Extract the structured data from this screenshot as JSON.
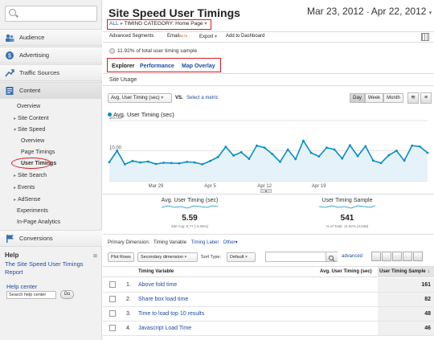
{
  "sidebar": {
    "sections": [
      {
        "label": "Audience",
        "icon": "audience-icon"
      },
      {
        "label": "Advertising",
        "icon": "advertising-icon"
      },
      {
        "label": "Traffic Sources",
        "icon": "traffic-sources-icon"
      },
      {
        "label": "Content",
        "icon": "content-icon"
      }
    ],
    "content_items": {
      "overview": "Overview",
      "site_content": "Site Content",
      "site_speed": "Site Speed",
      "speed_overview": "Overview",
      "page_timings": "Page Timings",
      "user_timings": "User Timings",
      "site_search": "Site Search",
      "events": "Events",
      "adsense": "AdSense",
      "experiments": "Experiments",
      "in_page": "In-Page Analytics"
    },
    "conversions": "Conversions",
    "help": {
      "header": "Help",
      "link": "The Site Speed User Timings Report",
      "help_center": "Help center",
      "search_placeholder": "Search help center",
      "go": "Go"
    }
  },
  "header": {
    "title": "Site Speed User Timings",
    "date_start": "Mar 23, 2012",
    "date_sep": "-",
    "date_end": "Apr 22, 2012",
    "breadcrumb_all": "ALL",
    "breadcrumb_sep": "»",
    "breadcrumb_cat": "TIMING CATEGORY: Home Page"
  },
  "toolbar": {
    "advanced_segments": "Advanced Segments",
    "email": "Email",
    "beta": "BETA",
    "export": "Export",
    "add_dashboard": "Add to Dashboard"
  },
  "sample_note": "11.92% of total user timing sample",
  "tabs": [
    "Explorer",
    "Performance",
    "Map Overlay"
  ],
  "subtab": "Site Usage",
  "chart_controls": {
    "metric": "Avg. User Timing (sec)",
    "vs": "VS.",
    "select_metric": "Select a metric",
    "periods": [
      "Day",
      "Week",
      "Month"
    ]
  },
  "chart_data": {
    "type": "line",
    "series": [
      {
        "name": "Avg. User Timing (sec)",
        "color": "#058dc7",
        "values": [
          6.2,
          10.0,
          5.5,
          6.6,
          6.1,
          6.4,
          5.6,
          6.0,
          5.9,
          5.8,
          6.3,
          6.1,
          5.5,
          6.6,
          7.9,
          11.3,
          8.4,
          9.5,
          7.3,
          11.7,
          11.0,
          8.9,
          6.3,
          10.4,
          7.2,
          13.3,
          9.3,
          8.1,
          11.0,
          10.4,
          7.4,
          11.8,
          8.2,
          11.5,
          6.7,
          5.9,
          8.5,
          10.0,
          6.7,
          11.7,
          11.4,
          9.3
        ]
      }
    ],
    "y_ticks": [
      "20.00",
      "10.00"
    ],
    "ylim": [
      0,
      20
    ],
    "x_ticks": [
      "Mar 29",
      "Apr 5",
      "Apr 12",
      "Apr 19"
    ]
  },
  "summary": [
    {
      "label": "Avg. User Timing (sec)",
      "value": "5.59",
      "sub": "Site Avg: 5.77 (-3.06%)"
    },
    {
      "label": "User Timing Sample",
      "value": "541",
      "sub": "% of Total: 11.92% (4,538)"
    }
  ],
  "table_controls": {
    "primary_label": "Primary Dimension:",
    "dim_active": "Timing Variable",
    "dim_label": "Timing Label",
    "dim_other": "Other",
    "plot_rows": "Plot Rows",
    "secondary": "Secondary dimension",
    "sort_type_label": "Sort Type:",
    "sort_default": "Default",
    "advanced": "advanced"
  },
  "table": {
    "headers": [
      "Timing Variable",
      "Avg. User Timing (sec)",
      "User Timing Sample"
    ],
    "rows": [
      {
        "num": "1.",
        "name": "Above fold time",
        "avg": "4.37",
        "sample": "161"
      },
      {
        "num": "2.",
        "name": "Share box load time",
        "avg": "7.73",
        "sample": "82"
      },
      {
        "num": "3.",
        "name": "Time to load top 10 results",
        "avg": "6.12",
        "sample": "48"
      },
      {
        "num": "4.",
        "name": "Javascript Load Time",
        "avg": "8.12",
        "sample": "46"
      }
    ]
  }
}
